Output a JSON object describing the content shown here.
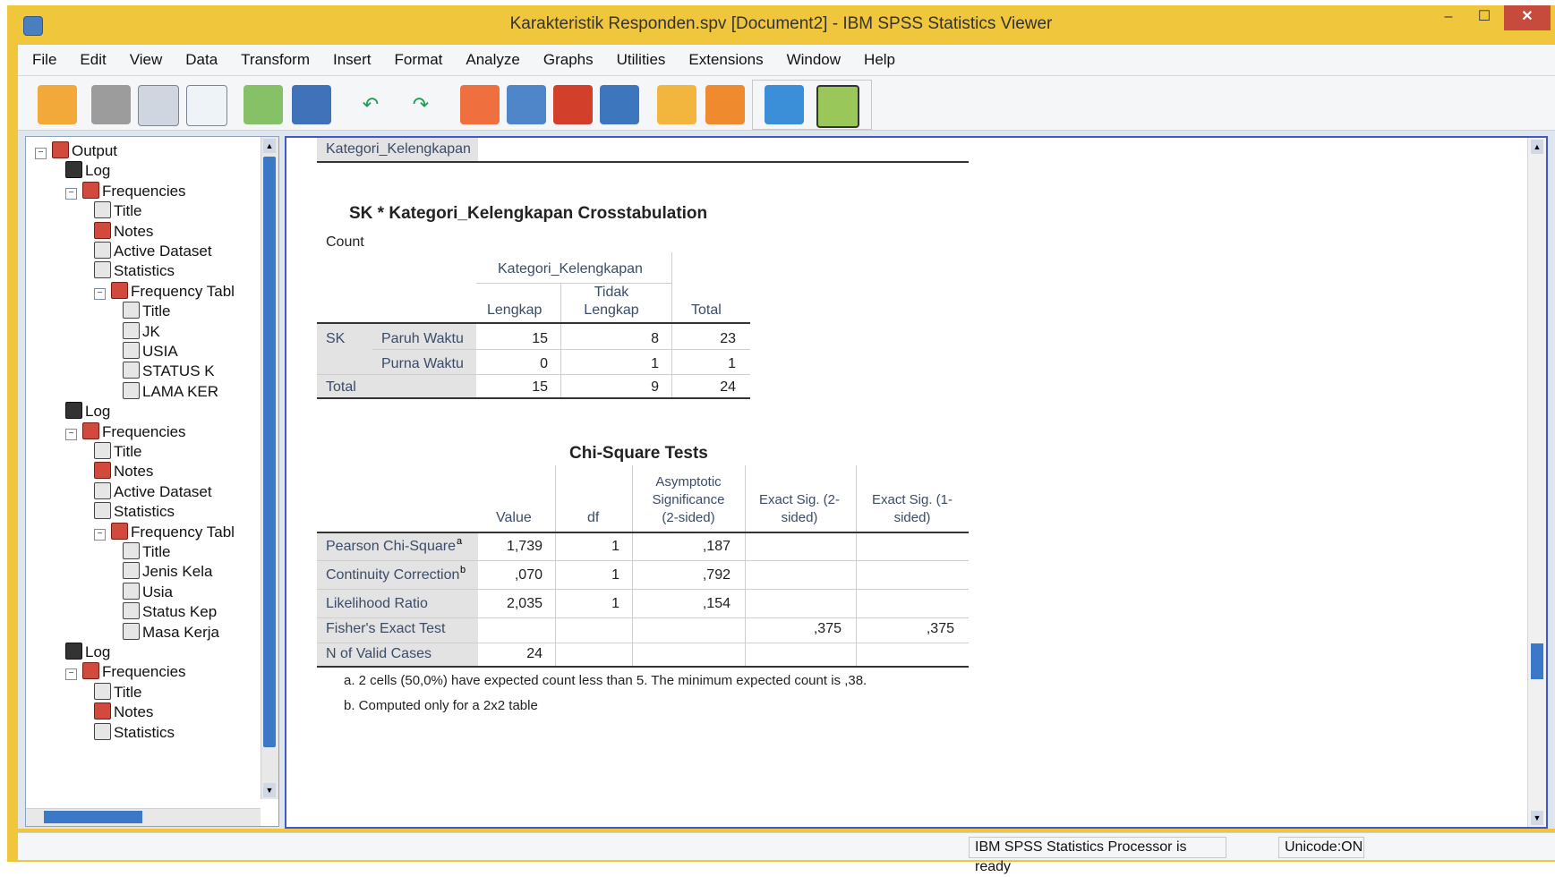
{
  "window": {
    "title": "Karakteristik Responden.spv [Document2] - IBM SPSS Statistics Viewer",
    "min": "–",
    "max": "☐",
    "close": "✕"
  },
  "menu": [
    "File",
    "Edit",
    "View",
    "Data",
    "Transform",
    "Insert",
    "Format",
    "Analyze",
    "Graphs",
    "Utilities",
    "Extensions",
    "Window",
    "Help"
  ],
  "toolbar_icons": [
    "open-icon",
    "save-icon",
    "print-icon",
    "print-preview-icon",
    "export-icon",
    "recall-dialog-icon",
    "undo-icon",
    "redo-icon",
    "goto-case-icon",
    "goto-variable-icon",
    "insert-chart-icon",
    "variables-icon",
    "designate-window-icon",
    "show-output-icon",
    "select-last-output-icon",
    "add-object-icon"
  ],
  "nav": {
    "items": [
      {
        "label": "Output",
        "level": 0,
        "icon": "red",
        "toggle": "−"
      },
      {
        "label": "Log",
        "level": 1,
        "icon": "log"
      },
      {
        "label": "Frequencies",
        "level": 1,
        "icon": "red",
        "toggle": "−"
      },
      {
        "label": "Title",
        "level": 2,
        "icon": "tbl"
      },
      {
        "label": "Notes",
        "level": 2,
        "icon": "red"
      },
      {
        "label": "Active Dataset",
        "level": 2,
        "icon": "tbl"
      },
      {
        "label": "Statistics",
        "level": 2,
        "icon": "tbl"
      },
      {
        "label": "Frequency Tabl",
        "level": 2,
        "icon": "red",
        "toggle": "−"
      },
      {
        "label": "Title",
        "level": 3,
        "icon": "tbl"
      },
      {
        "label": "JK",
        "level": 3,
        "icon": "tbl"
      },
      {
        "label": "USIA",
        "level": 3,
        "icon": "tbl"
      },
      {
        "label": "STATUS K",
        "level": 3,
        "icon": "tbl"
      },
      {
        "label": "LAMA KER",
        "level": 3,
        "icon": "tbl"
      },
      {
        "label": "Log",
        "level": 1,
        "icon": "log"
      },
      {
        "label": "Frequencies",
        "level": 1,
        "icon": "red",
        "toggle": "−"
      },
      {
        "label": "Title",
        "level": 2,
        "icon": "tbl"
      },
      {
        "label": "Notes",
        "level": 2,
        "icon": "red"
      },
      {
        "label": "Active Dataset",
        "level": 2,
        "icon": "tbl"
      },
      {
        "label": "Statistics",
        "level": 2,
        "icon": "tbl"
      },
      {
        "label": "Frequency Tabl",
        "level": 2,
        "icon": "red",
        "toggle": "−"
      },
      {
        "label": "Title",
        "level": 3,
        "icon": "tbl"
      },
      {
        "label": "Jenis Kela",
        "level": 3,
        "icon": "tbl"
      },
      {
        "label": "Usia",
        "level": 3,
        "icon": "tbl"
      },
      {
        "label": "Status Kep",
        "level": 3,
        "icon": "tbl"
      },
      {
        "label": "Masa Kerja",
        "level": 3,
        "icon": "tbl"
      },
      {
        "label": "Log",
        "level": 1,
        "icon": "log"
      },
      {
        "label": "Frequencies",
        "level": 1,
        "icon": "red",
        "toggle": "−"
      },
      {
        "label": "Title",
        "level": 2,
        "icon": "tbl"
      },
      {
        "label": "Notes",
        "level": 2,
        "icon": "red"
      },
      {
        "label": "Statistics",
        "level": 2,
        "icon": "tbl"
      }
    ]
  },
  "prev_table": {
    "row_label": "Kategori_Kelengkapan"
  },
  "crosstab": {
    "title": "SK * Kategori_Kelengkapan Crosstabulation",
    "count_label": "Count",
    "col_group": "Kategori_Kelengkapan",
    "col1": "Lengkap",
    "col2a": "Tidak",
    "col2b": "Lengkap",
    "col_total": "Total",
    "row_group": "SK",
    "rows": [
      {
        "label": "Paruh Waktu",
        "lengkap": "15",
        "tidak": "8",
        "total": "23"
      },
      {
        "label": "Purna Waktu",
        "lengkap": "0",
        "tidak": "1",
        "total": "1"
      }
    ],
    "total_row": {
      "label": "Total",
      "lengkap": "15",
      "tidak": "9",
      "total": "24"
    }
  },
  "chisq": {
    "title": "Chi-Square Tests",
    "headers": {
      "value": "Value",
      "df": "df",
      "asym1": "Asymptotic",
      "asym2": "Significance",
      "asym3": "(2-sided)",
      "ex2a": "Exact Sig. (2-",
      "ex2b": "sided)",
      "ex1a": "Exact Sig. (1-",
      "ex1b": "sided)"
    },
    "rows": [
      {
        "label": "Pearson Chi-Square",
        "sup": "a",
        "value": "1,739",
        "df": "1",
        "asym": ",187",
        "ex2": "",
        "ex1": ""
      },
      {
        "label": "Continuity Correction",
        "sup": "b",
        "value": ",070",
        "df": "1",
        "asym": ",792",
        "ex2": "",
        "ex1": ""
      },
      {
        "label": "Likelihood Ratio",
        "sup": "",
        "value": "2,035",
        "df": "1",
        "asym": ",154",
        "ex2": "",
        "ex1": ""
      },
      {
        "label": "Fisher's Exact Test",
        "sup": "",
        "value": "",
        "df": "",
        "asym": "",
        "ex2": ",375",
        "ex1": ",375"
      },
      {
        "label": "N of Valid Cases",
        "sup": "",
        "value": "24",
        "df": "",
        "asym": "",
        "ex2": "",
        "ex1": ""
      }
    ],
    "footnote_a": "a. 2 cells (50,0%) have expected count less than 5. The minimum expected count is ,38.",
    "footnote_b": "b. Computed only for a 2x2 table"
  },
  "status": {
    "processor": "IBM SPSS Statistics Processor is ready",
    "unicode": "Unicode:ON"
  }
}
